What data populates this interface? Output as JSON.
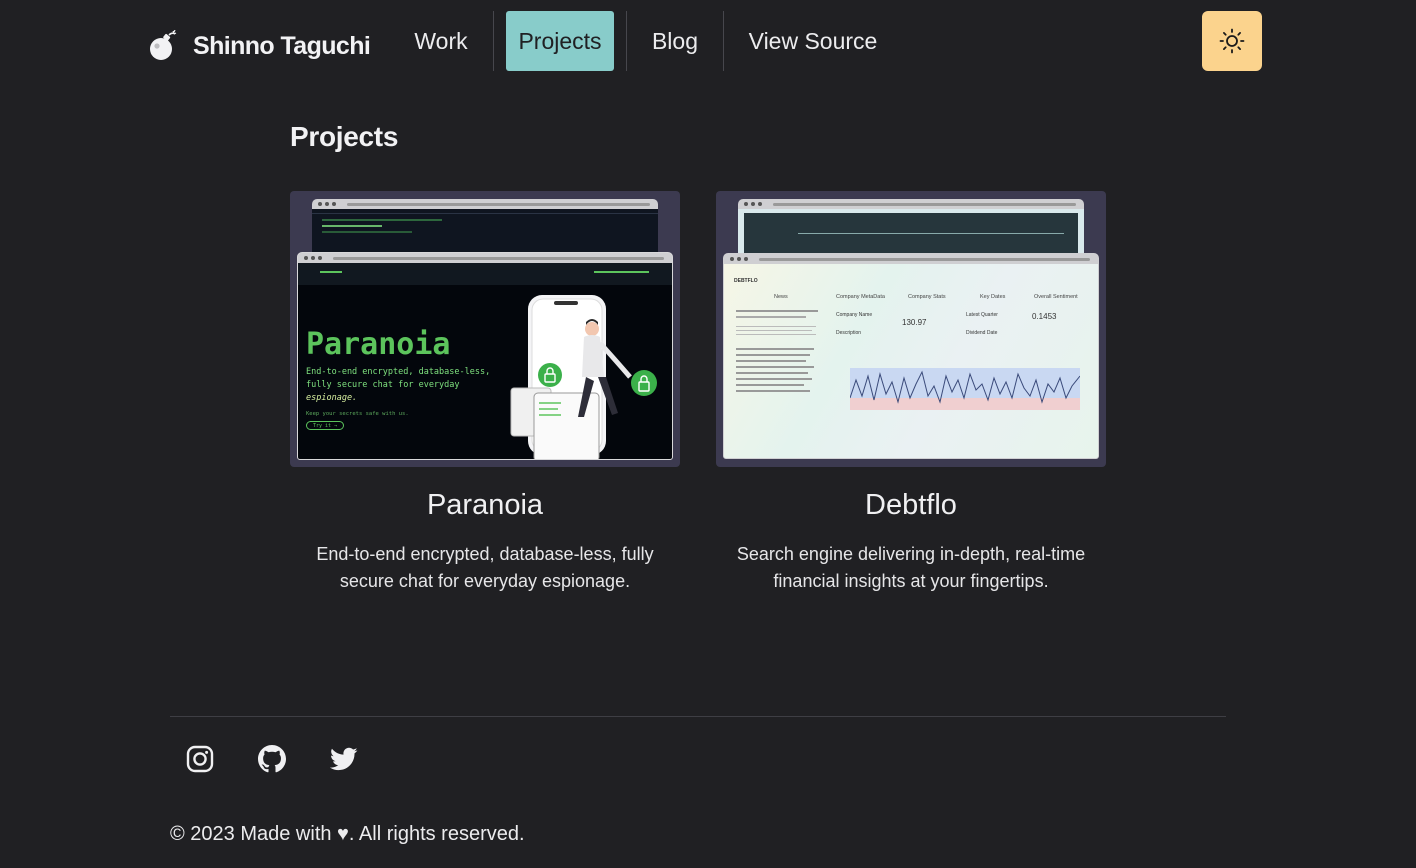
{
  "header": {
    "logo_text": "Shinno Taguchi",
    "nav": [
      {
        "label": "Work",
        "active": false
      },
      {
        "label": "Projects",
        "active": true
      },
      {
        "label": "Blog",
        "active": false
      },
      {
        "label": "View Source",
        "active": false
      }
    ],
    "theme_icon": "sun-icon"
  },
  "main": {
    "title": "Projects",
    "projects": [
      {
        "title": "Paranoia",
        "description": "End-to-end encrypted, database-less, fully secure chat for everyday espionage.",
        "thumb": {
          "heading": "Paranoia",
          "line1": "End-to-end encrypted, database-less,",
          "line2": "fully secure chat for everyday",
          "line3": "espionage.",
          "small": "Keep your secrets safe with us.",
          "button": "Try it →"
        }
      },
      {
        "title": "Debtflo",
        "description": "Search engine delivering in-depth, real-time financial insights at your fingertips.",
        "thumb": {
          "brand": "DEBTFLO",
          "columns": [
            "News",
            "Company MetaData",
            "Company Stats",
            "Key Dates",
            "Overall Sentiment"
          ],
          "company_label": "Company Name",
          "stat_value": "130.97",
          "sentiment_value": "0.1453",
          "key_dates_label": "Latest Quarter",
          "dividend_label": "Dividend Date",
          "description_label": "Description"
        }
      }
    ]
  },
  "footer": {
    "social": [
      "instagram-icon",
      "github-icon",
      "twitter-icon"
    ],
    "copyright": "© 2023 Made with ♥. All rights reserved."
  },
  "colors": {
    "background": "#202023",
    "nav_active": "#88ccca",
    "theme_toggle": "#fbd38d",
    "card_bg": "#3c3a50"
  }
}
